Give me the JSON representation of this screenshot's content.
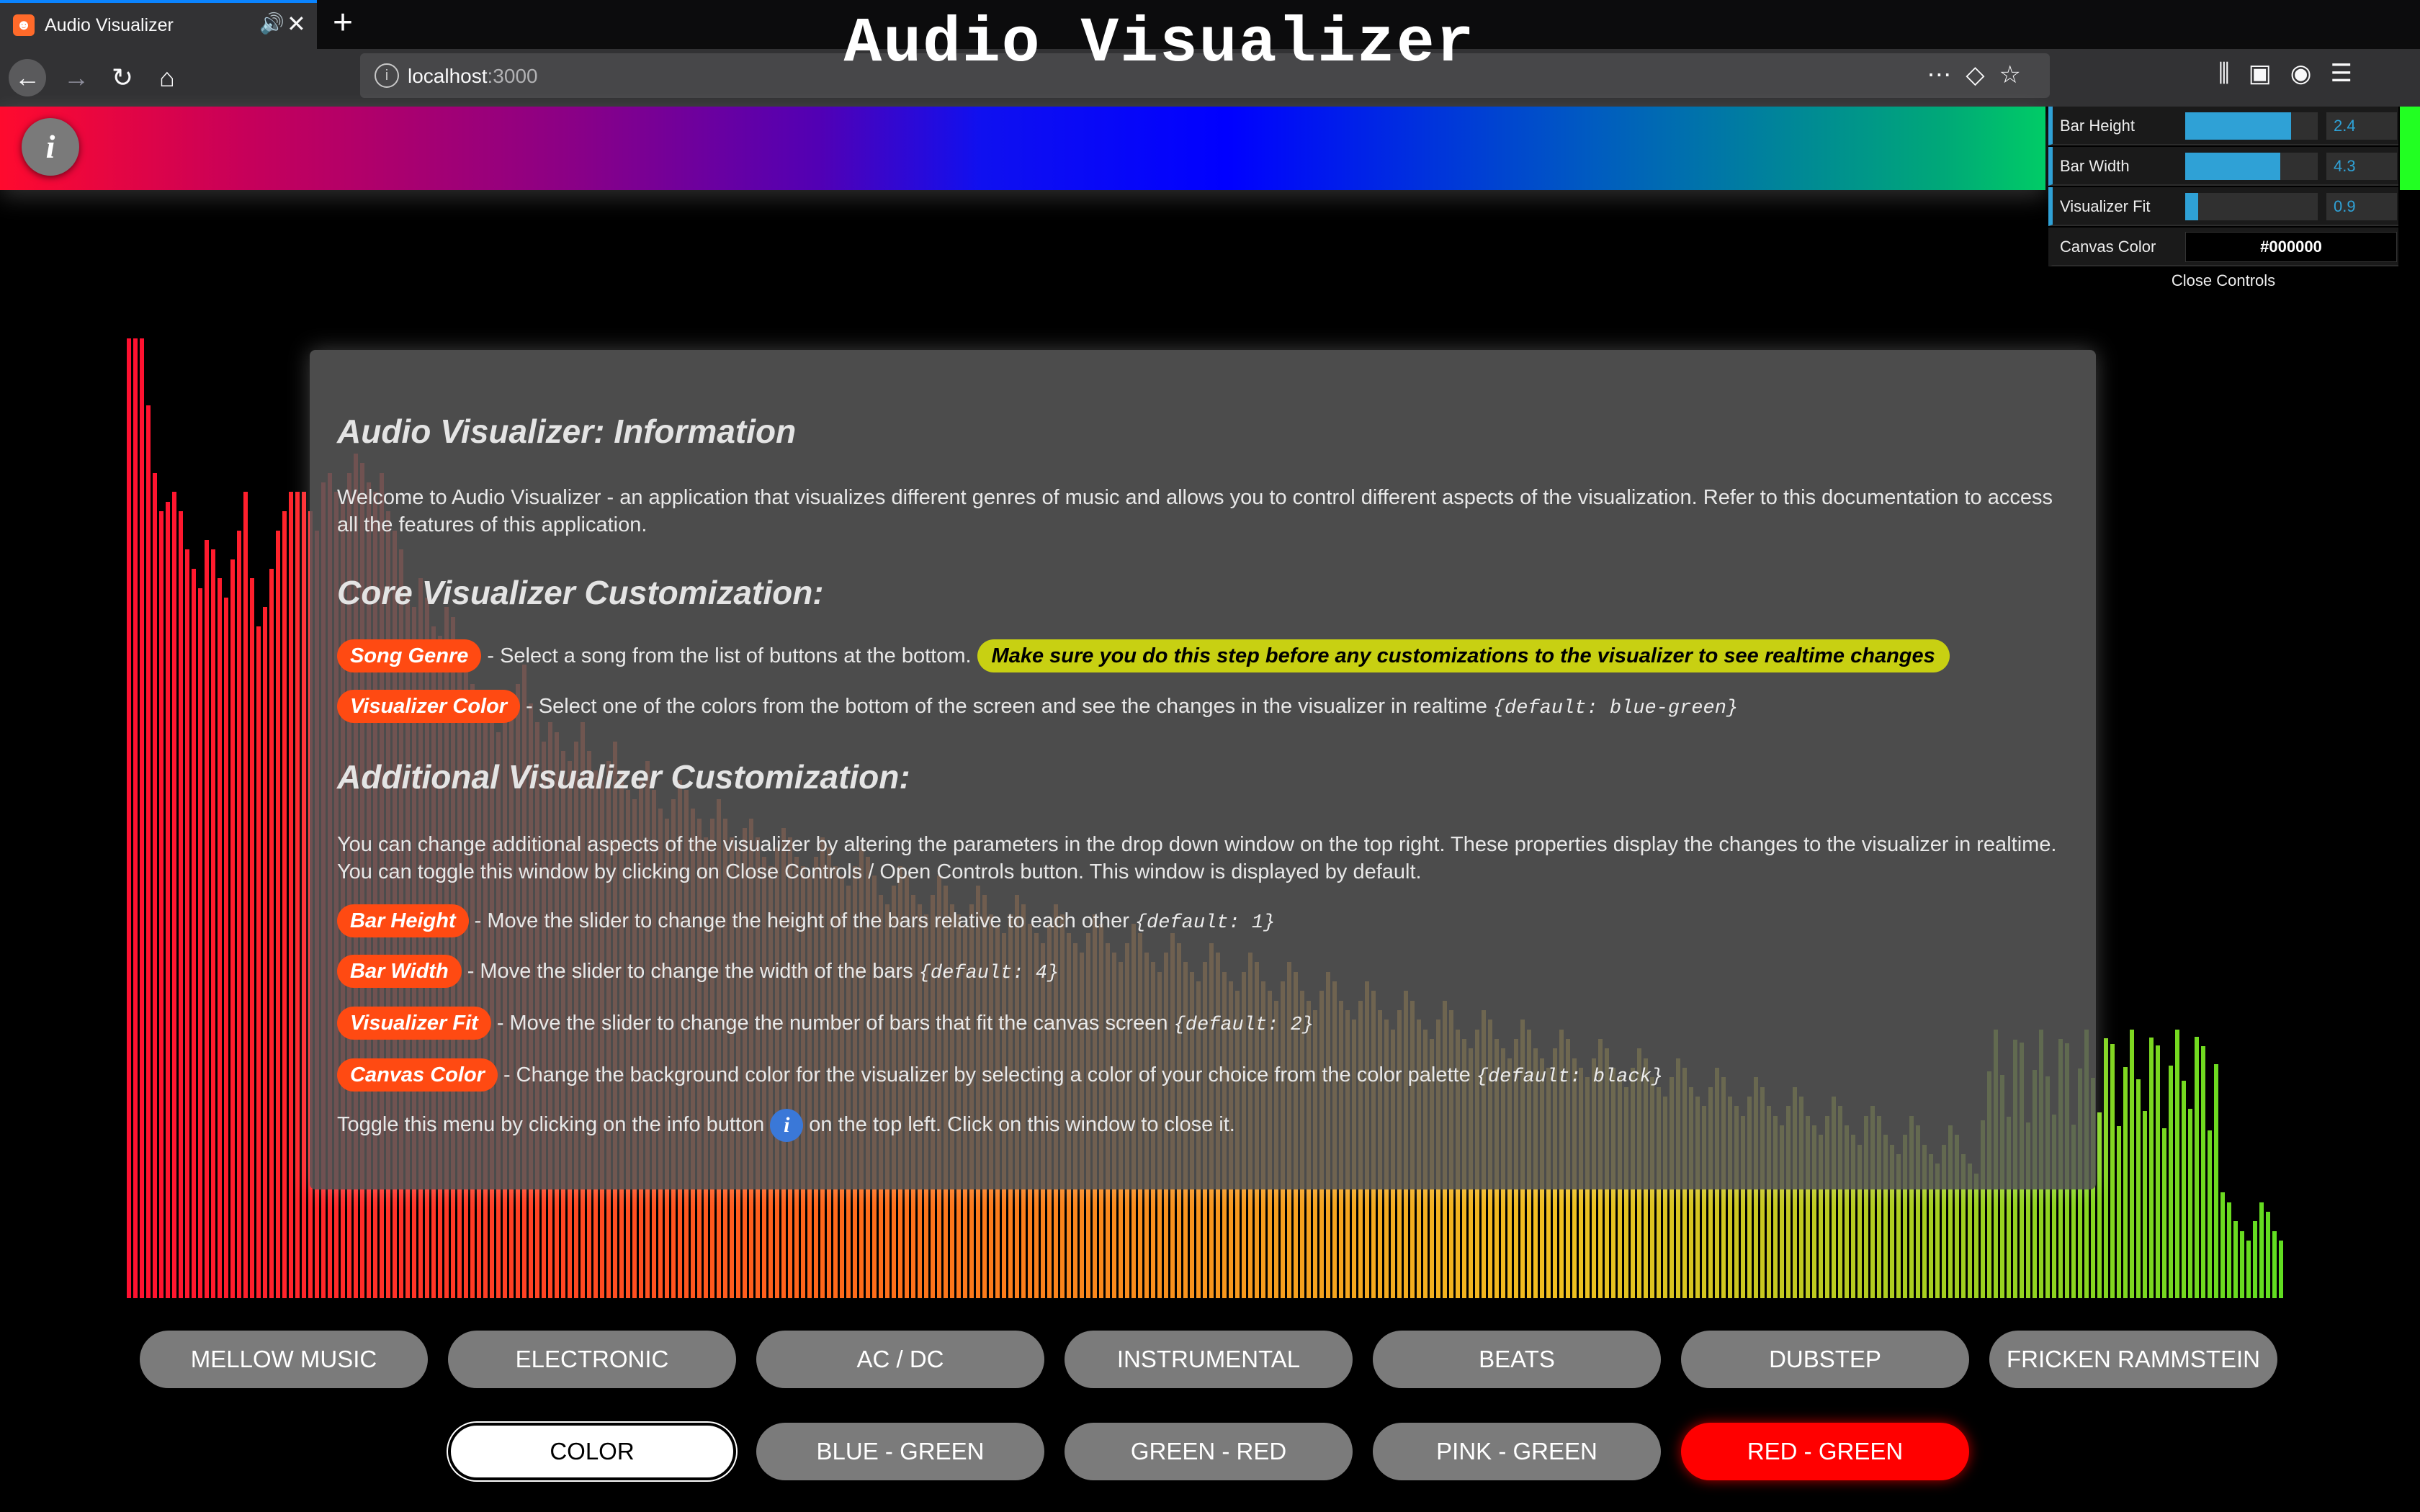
{
  "browser": {
    "tab_title": "Audio Visualizer",
    "url_host": "localhost",
    "url_port": ":3000"
  },
  "header": {
    "title": "Audio Visualizer",
    "info_button": "i"
  },
  "controls": {
    "bar_height": {
      "label": "Bar Height",
      "value": "2.4",
      "level": 0.8
    },
    "bar_width": {
      "label": "Bar Width",
      "value": "4.3",
      "level": 0.72
    },
    "visualizer_fit": {
      "label": "Visualizer Fit",
      "value": "0.9",
      "level": 0.1
    },
    "canvas_color": {
      "label": "Canvas Color",
      "value": "#000000"
    },
    "close_label": "Close Controls"
  },
  "info": {
    "title": "Audio Visualizer: Information",
    "welcome": "Welcome to Audio Visualizer - an application that visualizes different genres of music and allows you to control different aspects of the visualization. Refer to this documentation to access all the features of this application.",
    "core_heading": "Core Visualizer Customization:",
    "song_genre": {
      "tag": "Song Genre",
      "text": "- Select a song from the list of buttons at the bottom.",
      "warning": "Make sure you do this step before any customizations to the visualizer to see realtime changes"
    },
    "visualizer_color": {
      "tag": "Visualizer Color",
      "text": "- Select one of the colors from the bottom of the screen and see the changes in the visualizer in realtime",
      "default": "{default: blue-green}"
    },
    "additional_heading": "Additional Visualizer Customization:",
    "additional_text": "You can change additional aspects of the visualizer by altering the parameters in the drop down window on the top right. These properties display the changes to the visualizer in realtime. You can toggle this window by clicking on Close Controls / Open Controls button. This window is displayed by default.",
    "bar_height": {
      "tag": "Bar Height",
      "text": "- Move the slider to change the height of the bars relative to each other",
      "default": "{default: 1}"
    },
    "bar_width": {
      "tag": "Bar Width",
      "text": "- Move the slider to change the width of the bars",
      "default": "{default: 4}"
    },
    "visualizer_fit": {
      "tag": "Visualizer Fit",
      "text": "- Move the slider to change the number of bars that fit the canvas screen",
      "default": "{default: 2}"
    },
    "canvas_color": {
      "tag": "Canvas Color",
      "text": "- Change the background color for the visualizer by selecting a color of your choice from the color palette",
      "default": "{default: black}"
    },
    "toggle_before": "Toggle this menu by clicking on the info button",
    "toggle_icon": "i",
    "toggle_after": "on the top left. Click on this window to close it."
  },
  "genres": [
    "MELLOW MUSIC",
    "ELECTRONIC",
    "AC / DC",
    "INSTRUMENTAL",
    "BEATS",
    "DUBSTEP",
    "FRICKEN RAMMSTEIN"
  ],
  "colors": [
    "COLOR",
    "BLUE - GREEN",
    "GREEN - RED",
    "PINK - GREEN",
    "RED - GREEN"
  ],
  "active_color": "RED - GREEN",
  "visualizer": {
    "palette": [
      "#ff1030",
      "#ff6a1a",
      "#f0c020",
      "#60dd20"
    ],
    "levels": [
      1.0,
      1.0,
      1.0,
      0.93,
      0.86,
      0.82,
      0.83,
      0.84,
      0.82,
      0.78,
      0.76,
      0.74,
      0.79,
      0.78,
      0.75,
      0.73,
      0.77,
      0.8,
      0.84,
      0.75,
      0.7,
      0.72,
      0.76,
      0.8,
      0.82,
      0.84,
      0.84,
      0.84,
      0.82,
      0.8,
      0.85,
      0.86,
      0.84,
      0.83,
      0.86,
      0.88,
      0.87,
      0.85,
      0.84,
      0.86,
      0.82,
      0.8,
      0.78,
      0.74,
      0.72,
      0.75,
      0.73,
      0.7,
      0.69,
      0.72,
      0.71,
      0.68,
      0.66,
      0.64,
      0.62,
      0.6,
      0.61,
      0.59,
      0.6,
      0.62,
      0.64,
      0.66,
      0.62,
      0.6,
      0.58,
      0.6,
      0.59,
      0.57,
      0.56,
      0.58,
      0.6,
      0.57,
      0.55,
      0.54,
      0.56,
      0.58,
      0.55,
      0.53,
      0.52,
      0.54,
      0.56,
      0.53,
      0.51,
      0.5,
      0.52,
      0.54,
      0.53,
      0.51,
      0.5,
      0.48,
      0.5,
      0.52,
      0.5,
      0.48,
      0.47,
      0.49,
      0.5,
      0.48,
      0.46,
      0.45,
      0.47,
      0.49,
      0.48,
      0.46,
      0.45,
      0.44,
      0.46,
      0.48,
      0.47,
      0.45,
      0.44,
      0.43,
      0.45,
      0.47,
      0.46,
      0.44,
      0.42,
      0.41,
      0.43,
      0.45,
      0.44,
      0.42,
      0.41,
      0.4,
      0.42,
      0.44,
      0.43,
      0.41,
      0.4,
      0.39,
      0.41,
      0.43,
      0.42,
      0.4,
      0.39,
      0.38,
      0.4,
      0.42,
      0.41,
      0.39,
      0.38,
      0.37,
      0.39,
      0.41,
      0.4,
      0.38,
      0.37,
      0.36,
      0.38,
      0.4,
      0.39,
      0.37,
      0.36,
      0.35,
      0.37,
      0.39,
      0.38,
      0.36,
      0.35,
      0.34,
      0.36,
      0.38,
      0.37,
      0.35,
      0.34,
      0.33,
      0.35,
      0.37,
      0.36,
      0.34,
      0.33,
      0.32,
      0.34,
      0.36,
      0.35,
      0.33,
      0.32,
      0.31,
      0.33,
      0.35,
      0.34,
      0.32,
      0.31,
      0.3,
      0.32,
      0.34,
      0.33,
      0.31,
      0.3,
      0.29,
      0.31,
      0.33,
      0.32,
      0.3,
      0.29,
      0.28,
      0.3,
      0.32,
      0.31,
      0.29,
      0.28,
      0.27,
      0.29,
      0.31,
      0.3,
      0.28,
      0.27,
      0.26,
      0.28,
      0.3,
      0.29,
      0.27,
      0.26,
      0.25,
      0.27,
      0.29,
      0.28,
      0.26,
      0.25,
      0.24,
      0.26,
      0.28,
      0.27,
      0.25,
      0.24,
      0.23,
      0.25,
      0.27,
      0.26,
      0.24,
      0.23,
      0.22,
      0.24,
      0.26,
      0.25,
      0.23,
      0.22,
      0.21,
      0.23,
      0.25,
      0.24,
      0.22,
      0.21,
      0.2,
      0.22,
      0.24,
      0.23,
      0.21,
      0.2,
      0.19,
      0.21,
      0.23,
      0.22,
      0.2,
      0.19,
      0.18,
      0.2,
      0.22,
      0.21,
      0.19,
      0.18,
      0.17,
      0.19,
      0.21,
      0.2,
      0.18,
      0.17,
      0.16,
      0.19,
      0.2,
      0.19,
      0.17,
      0.16,
      0.15,
      0.17,
      0.19,
      0.18,
      0.16,
      0.15,
      0.14,
      0.16,
      0.18,
      0.17,
      0.15,
      0.14,
      0.13,
      0.15,
      0.17,
      0.16,
      0.14,
      0.13,
      0.12,
      0.14,
      0.16,
      0.15,
      0.13,
      0.12,
      0.11,
      0.13,
      0.15,
      0.14,
      0.12,
      0.11,
      0.1,
      0.12,
      0.14,
      0.13,
      0.11,
      0.1,
      0.09,
      0.11,
      0.13,
      0.12,
      0.1,
      0.09,
      0.08,
      0.1,
      0.12,
      0.11,
      0.09,
      0.08,
      0.07,
      0.09,
      0.11,
      0.1,
      0.08,
      0.07,
      0.06,
      0.08,
      0.1,
      0.09,
      0.07,
      0.06,
      0.05,
      0.07,
      0.09,
      0.08,
      0.06,
      0.05,
      0.04,
      0.06,
      0.08,
      0.07,
      0.05,
      0.04,
      0.03,
      0.05,
      0.07,
      0.06,
      0.04,
      0.03,
      0.02,
      0.04,
      0.06,
      0.05,
      0.03,
      0.02,
      0.01,
      0.03,
      0.05,
      0.04,
      0.02,
      0.01
    ]
  }
}
